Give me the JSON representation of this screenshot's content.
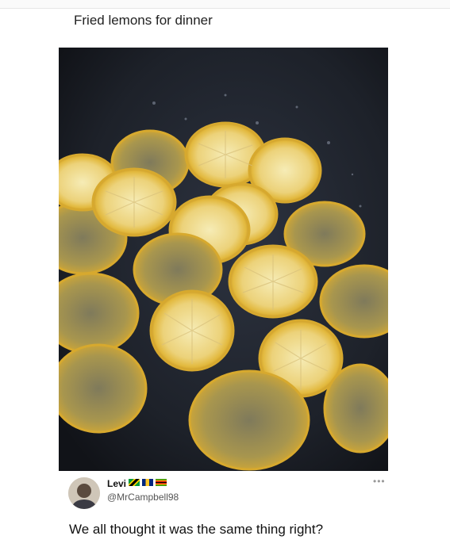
{
  "post": {
    "caption": "Fried lemons for dinner"
  },
  "photo": {
    "icon": "fried-lemons-photo",
    "description_colors": {
      "pan": "#1b1f27",
      "lemon_rind": "#e8c34a",
      "lemon_flesh": "#f3e4a0"
    }
  },
  "tweet": {
    "name": "Levi",
    "handle": "@MrCampbell98",
    "text": "We all thought it was the same thing right?",
    "more_icon": "•••",
    "flags": [
      "jamaica-flag",
      "barbados-flag",
      "zimbabwe-flag"
    ]
  }
}
